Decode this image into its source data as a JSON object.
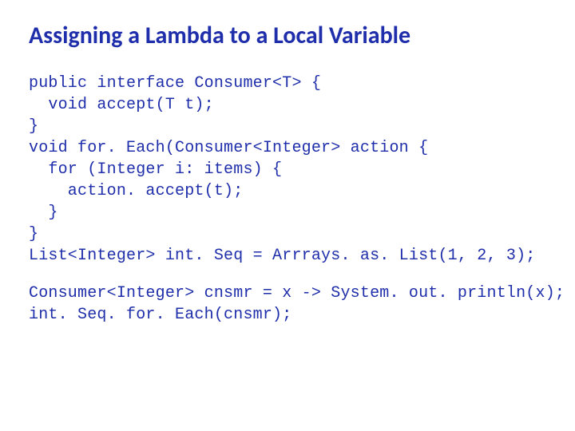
{
  "title": "Assigning a Lambda to a Local Variable",
  "code_block_1": "public interface Consumer<T> {\n  void accept(T t);\n}\nvoid for. Each(Consumer<Integer> action {\n  for (Integer i: items) {\n    action. accept(t);\n  }\n}\nList<Integer> int. Seq = Arrrays. as. List(1, 2, 3);",
  "code_block_2": "Consumer<Integer> cnsmr = x -> System. out. println(x);\nint. Seq. for. Each(cnsmr);"
}
